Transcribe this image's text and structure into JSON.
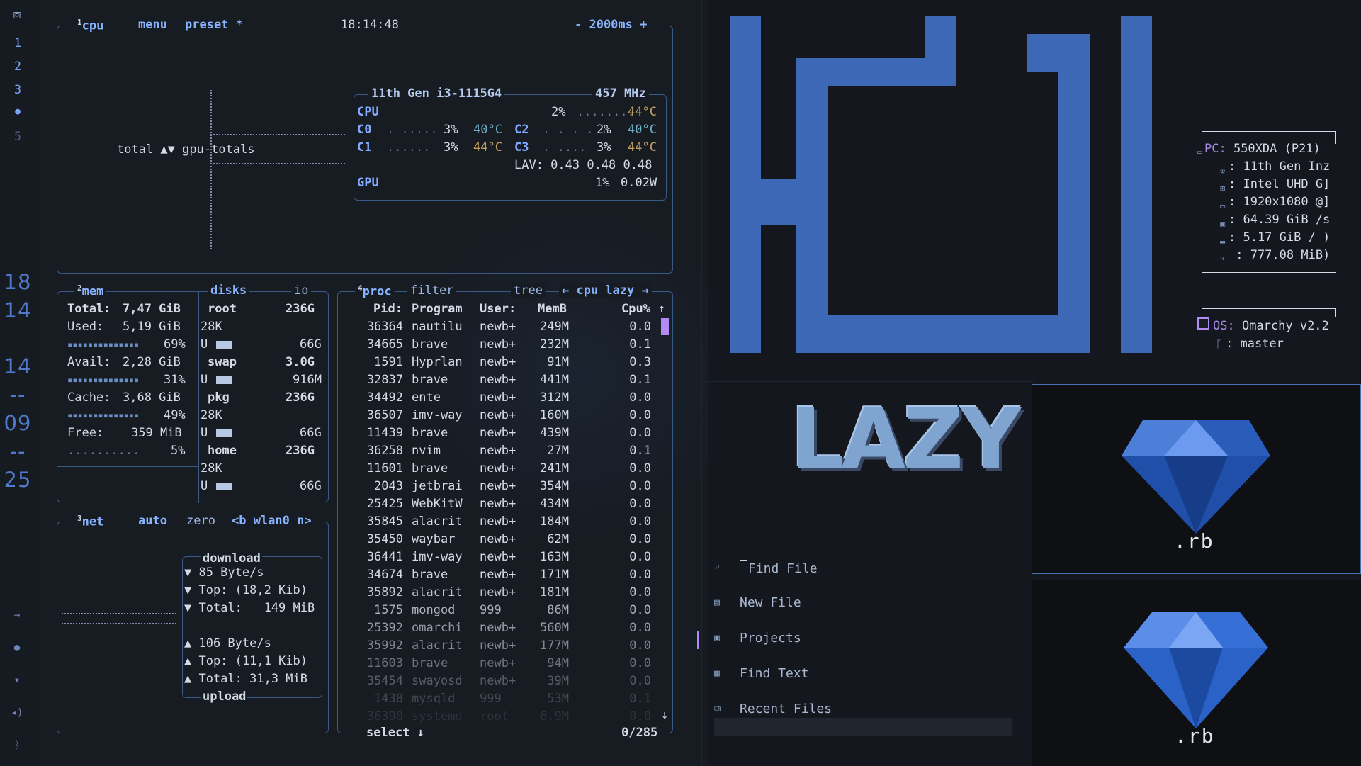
{
  "waybar": {
    "workspaces": [
      "1",
      "2",
      "3",
      "●",
      "5"
    ],
    "clock": [
      "18",
      "14",
      "14",
      "--",
      "09",
      "--",
      "25"
    ],
    "icons": [
      "logout-icon",
      "record-icon",
      "wifi-icon",
      "volume-icon",
      "bluetooth-icon"
    ]
  },
  "cpu": {
    "num": "1",
    "title": "cpu",
    "menu": "menu",
    "preset": "preset *",
    "time": "18:14:48",
    "interval": "- 2000ms +",
    "graph_label": "total ▲▼ gpu-totals",
    "model": "11th Gen i3-1115G4",
    "freq": "457 MHz",
    "rows": [
      {
        "k": "CPU",
        "bar": "",
        "pct": "2%",
        "dots": "........",
        "temp": "44°C"
      },
      {
        "k": "C0",
        "dots": ". .....",
        "pct": "3%",
        "temp": "40°C",
        "k2": "C2",
        "dots2": ". . . . .",
        "pct2": "2%",
        "temp2": "40°C"
      },
      {
        "k": "C1",
        "dots": "......",
        "pct": "3%",
        "temp": "44°C",
        "k2": "C3",
        "dots2": ". ....",
        "pct2": "3%",
        "temp2": "44°C"
      }
    ],
    "lav": "LAV: 0.43 0.48 0.48",
    "gpu": {
      "k": "GPU",
      "pct": "1%",
      "watt": "0.02W"
    }
  },
  "mem": {
    "num": "2",
    "title": "mem",
    "disks_title": "disks",
    "io": "io",
    "rows": [
      {
        "label": "Total:",
        "value": "7,47 GiB"
      },
      {
        "label": "Used:",
        "value": "5,19 GiB",
        "pct": "69%"
      },
      {
        "label": "Avail:",
        "value": "2,28 GiB",
        "pct": "31%"
      },
      {
        "label": "Cache:",
        "value": "3,68 GiB",
        "pct": "49%"
      },
      {
        "label": "Free:",
        "value": "359 MiB",
        "pct": "5%"
      }
    ],
    "disks": [
      {
        "name": "root",
        "size": "236G",
        "r": "28K",
        "u": "U",
        "free": "66G"
      },
      {
        "name": "swap",
        "size": "3.0G",
        "r": "",
        "u": "U",
        "free": "916M"
      },
      {
        "name": "pkg",
        "size": "236G",
        "r": "28K",
        "u": "U",
        "free": "66G"
      },
      {
        "name": "home",
        "size": "236G",
        "r": "28K",
        "u": "U",
        "free": "66G"
      }
    ]
  },
  "net": {
    "num": "3",
    "title": "net",
    "auto": "auto",
    "zero": "zero",
    "iface": "<b wlan0 n>",
    "download": "download",
    "dl_rate": "▼ 85 Byte/s",
    "dl_top": "▼ Top: (18,2 Kib)",
    "dl_total": "▼ Total:   149 MiB",
    "ul_rate": "▲ 106 Byte/s",
    "ul_top": "▲ Top: (11,1 Kib)",
    "ul_total": "▲ Total: 31,3 MiB",
    "upload": "upload"
  },
  "proc": {
    "num": "4",
    "title": "proc",
    "filter": "filter",
    "tree": "tree",
    "sort": "← cpu lazy →",
    "headers": [
      "Pid:",
      "Program",
      "User:",
      "MemB",
      "Cpu%"
    ],
    "rows": [
      [
        "36364",
        "nautilu",
        "newb+",
        "249M",
        "0.0"
      ],
      [
        "34665",
        "brave",
        "newb+",
        "232M",
        "0.1"
      ],
      [
        "1591",
        "Hyprlan",
        "newb+",
        "91M",
        "0.3"
      ],
      [
        "32837",
        "brave",
        "newb+",
        "441M",
        "0.1"
      ],
      [
        "34492",
        "ente",
        "newb+",
        "312M",
        "0.0"
      ],
      [
        "36507",
        "imv-way",
        "newb+",
        "160M",
        "0.0"
      ],
      [
        "11439",
        "brave",
        "newb+",
        "439M",
        "0.0"
      ],
      [
        "36258",
        "nvim",
        "newb+",
        "27M",
        "0.1"
      ],
      [
        "11601",
        "brave",
        "newb+",
        "241M",
        "0.0"
      ],
      [
        "2043",
        "jetbrai",
        "newb+",
        "354M",
        "0.0"
      ],
      [
        "25425",
        "WebKitW",
        "newb+",
        "434M",
        "0.0"
      ],
      [
        "35845",
        "alacrit",
        "newb+",
        "184M",
        "0.0"
      ],
      [
        "35450",
        "waybar",
        "newb+",
        "62M",
        "0.0"
      ],
      [
        "36441",
        "imv-way",
        "newb+",
        "163M",
        "0.0"
      ],
      [
        "34674",
        "brave",
        "newb+",
        "171M",
        "0.0"
      ],
      [
        "35892",
        "alacrit",
        "newb+",
        "181M",
        "0.0"
      ],
      [
        "1575",
        "mongod",
        "999",
        "86M",
        "0.0"
      ],
      [
        "25392",
        "omarchi",
        "newb+",
        "560M",
        "0.0"
      ],
      [
        "35992",
        "alacrit",
        "newb+",
        "177M",
        "0.0"
      ],
      [
        "11603",
        "brave",
        "newb+",
        "94M",
        "0.0"
      ],
      [
        "35454",
        "swayosd",
        "newb+",
        "39M",
        "0.0"
      ],
      [
        "1438",
        "mysqld",
        "999",
        "53M",
        "0.1"
      ],
      [
        "36390",
        "systemd",
        "root",
        "6.9M",
        "0.0"
      ]
    ],
    "select": "select ↓",
    "count": "0/285",
    "up": "↑",
    "down": "↓"
  },
  "dashboard": {
    "lazy_text": "LAZY",
    "menu": [
      {
        "icon": "search-icon",
        "label": "Find File",
        "glyph": "⌕"
      },
      {
        "icon": "file-icon",
        "label": "New File",
        "glyph": "▤"
      },
      {
        "icon": "folder-icon",
        "label": "Projects",
        "glyph": "▣"
      },
      {
        "icon": "text-search-icon",
        "label": "Find Text",
        "glyph": "▦"
      },
      {
        "icon": "recent-icon",
        "label": "Recent Files",
        "glyph": "⧉"
      }
    ]
  },
  "fastfetch": {
    "pc": {
      "k": "PC:",
      "v": " 550XDA (P21)"
    },
    "lines": [
      ": 11th Gen Inz",
      ": Intel UHD G]",
      ": 1920x1080 @]",
      ": 64.39 GiB /s",
      ": 5.17 GiB / )",
      " : 777.08 MiB)"
    ],
    "os": {
      "k": "OS:",
      "v": " Omarchy v2.2"
    },
    "branch": ": master"
  },
  "images": {
    "label_top": ".rb",
    "label_bottom": ".rb"
  },
  "colors": {
    "accent": "#7aa2f7",
    "logo_blue": "#3d68b6",
    "purple": "#b28bf2",
    "border": "#3a5a86"
  }
}
